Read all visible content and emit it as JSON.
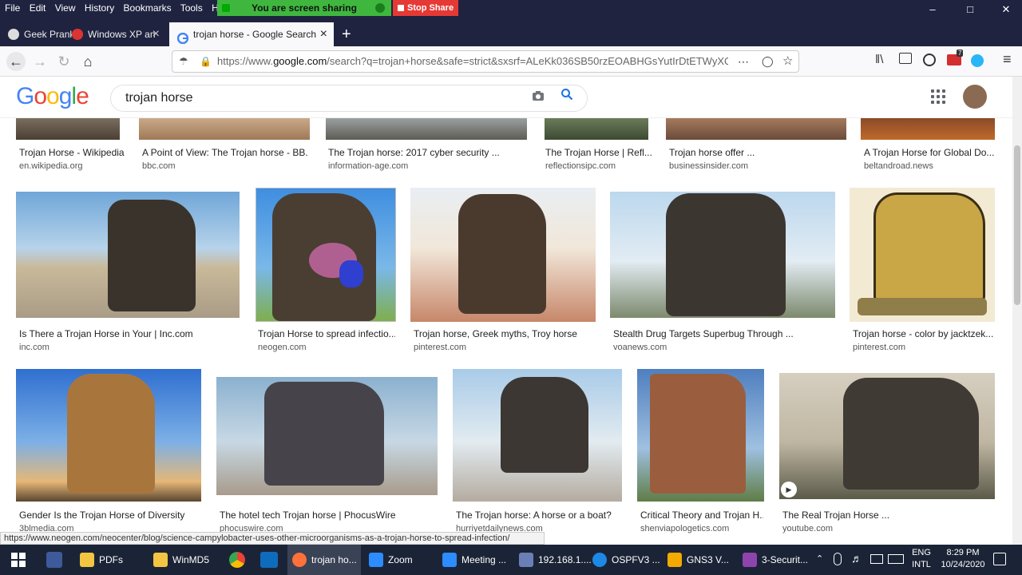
{
  "menubar": {
    "items": [
      "File",
      "Edit",
      "View",
      "History",
      "Bookmarks",
      "Tools",
      "Help"
    ],
    "share_banner": "You are screen sharing",
    "stop_share": "Stop Share"
  },
  "tabs": [
    {
      "label": "Geek Prank"
    },
    {
      "label": "Windows XP an"
    },
    {
      "label": "trojan horse - Google Search"
    }
  ],
  "url": {
    "prefix": "https://www.",
    "domain": "google.com",
    "rest": "/search?q=trojan+horse&safe=strict&sxsrf=ALeKk036SB50rzEOABHGsYutIrDtETWyXQ:"
  },
  "toolbar": {
    "badge_count": "7"
  },
  "google": {
    "logo": "Google",
    "query": "trojan horse"
  },
  "row1": [
    {
      "title": "Trojan Horse - Wikipedia",
      "source": "en.wikipedia.org"
    },
    {
      "title": "A Point of View: The Trojan horse - BB...",
      "source": "bbc.com"
    },
    {
      "title": "The Trojan horse: 2017 cyber security ...",
      "source": "information-age.com"
    },
    {
      "title": "The Trojan Horse | Refl...",
      "source": "reflectionsipc.com"
    },
    {
      "title": "Trojan horse offer ...",
      "source": "businessinsider.com"
    },
    {
      "title": "A Trojan Horse for Global Do...",
      "source": "beltandroad.news"
    }
  ],
  "row2": [
    {
      "title": "Is There a Trojan Horse in Your | Inc.com",
      "source": "inc.com"
    },
    {
      "title": "Trojan Horse to spread infectio...",
      "source": "neogen.com"
    },
    {
      "title": "Trojan horse, Greek myths, Troy horse",
      "source": "pinterest.com"
    },
    {
      "title": "Stealth Drug Targets Superbug Through ...",
      "source": "voanews.com"
    },
    {
      "title": "Trojan horse - color by jacktzek...",
      "source": "pinterest.com"
    }
  ],
  "row3": [
    {
      "title": "Gender Is the Trojan Horse of Diversity",
      "source": "3blmedia.com"
    },
    {
      "title": "The hotel tech Trojan horse | PhocusWire",
      "source": "phocuswire.com"
    },
    {
      "title": "The Trojan horse: A horse or a boat?",
      "source": "hurriyetdailynews.com"
    },
    {
      "title": "Critical Theory and Trojan H...",
      "source": "shenviapologetics.com"
    },
    {
      "title": "The Real Trojan Horse ...",
      "source": "youtube.com"
    }
  ],
  "status_url": "https://www.neogen.com/neocenter/blog/science-campylobacter-uses-other-microorganisms-as-a-trojan-horse-to-spread-infection/",
  "taskbar": {
    "items": [
      {
        "label": "PDFs"
      },
      {
        "label": "WinMD5"
      },
      {
        "label": "trojan ho..."
      },
      {
        "label": "Zoom"
      },
      {
        "label": "Meeting ..."
      },
      {
        "label": "192.168.1...."
      },
      {
        "label": "OSPFV3 ..."
      },
      {
        "label": "GNS3 V..."
      },
      {
        "label": "3-Securit..."
      }
    ],
    "lang_top": "ENG",
    "lang_bottom": "INTL",
    "time": "8:29 PM",
    "date": "10/24/2020"
  },
  "colors": {
    "google_blue": "#4285F4",
    "google_red": "#EA4335",
    "google_yellow": "#FBBC05",
    "google_green": "#34A853",
    "share_green": "#3fb73f",
    "stop_red": "#e53935"
  }
}
